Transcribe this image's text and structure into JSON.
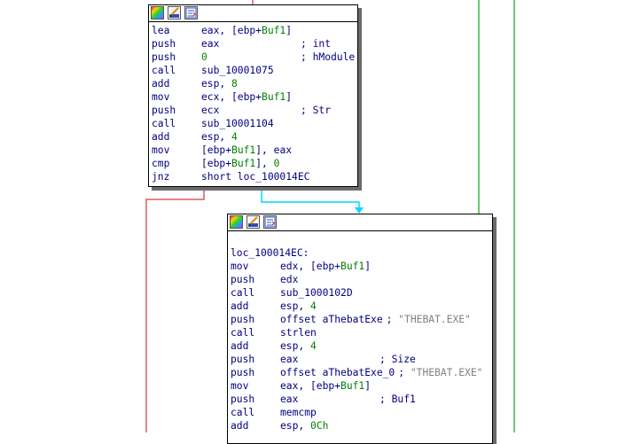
{
  "colors": {
    "edge_false": "#e05a5a",
    "edge_true": "#00d8ff",
    "edge_green": "#3cb84a",
    "number": "#008000",
    "text": "#000080",
    "string_comment": "#808080"
  },
  "toolbar_icons": [
    "color-palette-icon",
    "rename-node-icon",
    "graph-view-icon"
  ],
  "block1": {
    "lines": [
      {
        "mnemonic": "lea",
        "operand": "eax, [ebp+Buf1]",
        "comment": ""
      },
      {
        "mnemonic": "push",
        "operand": "eax",
        "comment": "; int"
      },
      {
        "mnemonic": "push",
        "operand": "0",
        "comment": "; hModule"
      },
      {
        "mnemonic": "call",
        "operand": "sub_10001075",
        "comment": ""
      },
      {
        "mnemonic": "add",
        "operand": "esp, 8",
        "comment": ""
      },
      {
        "mnemonic": "mov",
        "operand": "ecx, [ebp+Buf1]",
        "comment": ""
      },
      {
        "mnemonic": "push",
        "operand": "ecx",
        "comment": "; Str"
      },
      {
        "mnemonic": "call",
        "operand": "sub_10001104",
        "comment": ""
      },
      {
        "mnemonic": "add",
        "operand": "esp, 4",
        "comment": ""
      },
      {
        "mnemonic": "mov",
        "operand": "[ebp+Buf1], eax",
        "comment": ""
      },
      {
        "mnemonic": "cmp",
        "operand": "[ebp+Buf1], 0",
        "comment": ""
      },
      {
        "mnemonic": "jnz",
        "operand": "short loc_100014EC",
        "comment": ""
      }
    ]
  },
  "block2": {
    "label": "loc_100014EC:",
    "lines": [
      {
        "mnemonic": "mov",
        "operand": "edx, [ebp+Buf1]",
        "comment": ""
      },
      {
        "mnemonic": "push",
        "operand": "edx",
        "comment": ""
      },
      {
        "mnemonic": "call",
        "operand": "sub_1000102D",
        "comment": ""
      },
      {
        "mnemonic": "add",
        "operand": "esp, 4",
        "comment": ""
      },
      {
        "mnemonic": "push",
        "operand": "offset aThebatExe",
        "comment": "; \"THEBAT.EXE\""
      },
      {
        "mnemonic": "call",
        "operand": "strlen",
        "comment": ""
      },
      {
        "mnemonic": "add",
        "operand": "esp, 4",
        "comment": ""
      },
      {
        "mnemonic": "push",
        "operand": "eax",
        "comment": "; Size"
      },
      {
        "mnemonic": "push",
        "operand": "offset aThebatExe_0",
        "comment": "; \"THEBAT.EXE\""
      },
      {
        "mnemonic": "mov",
        "operand": "eax, [ebp+Buf1]",
        "comment": ""
      },
      {
        "mnemonic": "push",
        "operand": "eax",
        "comment": "; Buf1"
      },
      {
        "mnemonic": "call",
        "operand": "memcmp",
        "comment": ""
      },
      {
        "mnemonic": "add",
        "operand": "esp, 0Ch",
        "comment": ""
      }
    ]
  }
}
